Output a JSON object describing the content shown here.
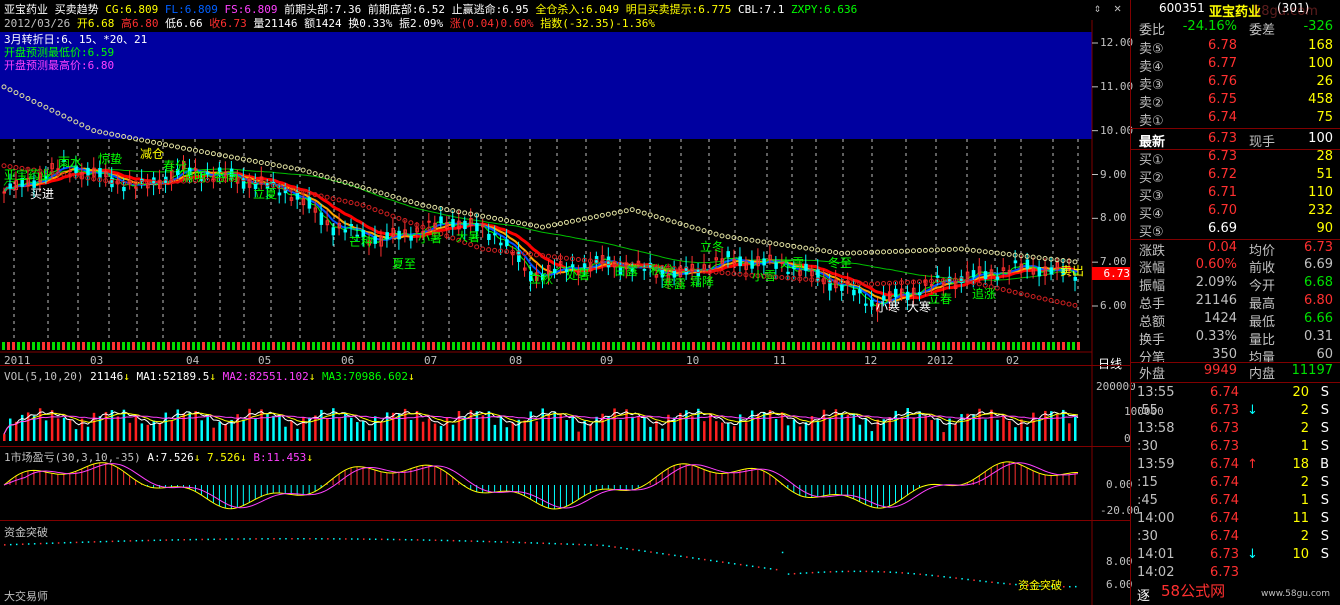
{
  "header": {
    "row1": [
      {
        "text": "亚宝药业",
        "color": "#ffffff"
      },
      {
        "text": "买卖趋势",
        "color": "#ffffff"
      },
      {
        "text": "CG:6.809",
        "color": "#ffff00"
      },
      {
        "text": "FL:6.809",
        "color": "#0060ff"
      },
      {
        "text": "FS:6.809",
        "color": "#ff40ff"
      },
      {
        "text": "前期头部:7.36",
        "color": "#ffffff"
      },
      {
        "text": "前期底部:6.52",
        "color": "#ffffff"
      },
      {
        "text": "止赢逃命:6.95",
        "color": "#ffffff"
      },
      {
        "text": "全仓杀入:6.049",
        "color": "#ffff00"
      },
      {
        "text": "明日买卖提示:6.775",
        "color": "#ffff00"
      },
      {
        "text": "CBL:7.1",
        "color": "#ffffff"
      },
      {
        "text": "ZXPY:6.636",
        "color": "#00ff00"
      }
    ],
    "row2": [
      {
        "text": "2012/03/26",
        "color": "#c0c0c0"
      },
      {
        "text": "开6.68",
        "color": "#ffff00"
      },
      {
        "text": "高6.80",
        "color": "#ff3030"
      },
      {
        "text": "低6.66",
        "color": "#ffffff"
      },
      {
        "text": "收6.73",
        "color": "#ff3030"
      },
      {
        "text": "量21146",
        "color": "#ffffff"
      },
      {
        "text": "额1424",
        "color": "#ffffff"
      },
      {
        "text": "换0.33%",
        "color": "#ffffff"
      },
      {
        "text": "振2.09%",
        "color": "#ffffff"
      },
      {
        "text": "涨(0.04)0.60%",
        "color": "#ff3030"
      },
      {
        "text": "指数(-32.35)-1.36%",
        "color": "#ffff00"
      }
    ],
    "overlay": {
      "line1": "3月转折日:6、15、*20、21",
      "line2": "开盘预测最低价:6.59",
      "line3": "开盘预测最高价:6.80",
      "left_label": "亚宝药业"
    }
  },
  "price_axis": {
    "ticks": [
      "12.00",
      "11.00",
      "10.00",
      "9.00",
      "8.00",
      "7.00",
      "6.00"
    ],
    "current": "6.73"
  },
  "date_axis": [
    "2011",
    "03",
    "04",
    "05",
    "06",
    "07",
    "08",
    "09",
    "10",
    "11",
    "12",
    "2012",
    "02",
    "03"
  ],
  "period_label": "日线",
  "annotations": [
    {
      "text": "雨水",
      "color": "#00ff00"
    },
    {
      "text": "惊蛰",
      "color": "#00ff00"
    },
    {
      "text": "减仓",
      "color": "#ffff00"
    },
    {
      "text": "春分",
      "color": "#00ff00"
    },
    {
      "text": "清明",
      "color": "#00ff00"
    },
    {
      "text": "谷雨",
      "color": "#00ff00"
    },
    {
      "text": "买进",
      "color": "#ffffff"
    },
    {
      "text": "立夏",
      "color": "#00ff00"
    },
    {
      "text": "芒种",
      "color": "#00ff00"
    },
    {
      "text": "夏至",
      "color": "#00ff00"
    },
    {
      "text": "小暑",
      "color": "#00ff00"
    },
    {
      "text": "大暑",
      "color": "#00ff00"
    },
    {
      "text": "立秋",
      "color": "#00ff00"
    },
    {
      "text": "处暑",
      "color": "#00ff00"
    },
    {
      "text": "白露",
      "color": "#00ff00"
    },
    {
      "text": "秋分",
      "color": "#00ff00"
    },
    {
      "text": "寒露",
      "color": "#00ff00"
    },
    {
      "text": "霜降",
      "color": "#00ff00"
    },
    {
      "text": "立冬",
      "color": "#00ff00"
    },
    {
      "text": "小雪",
      "color": "#00ff00"
    },
    {
      "text": "大雪",
      "color": "#00ff00"
    },
    {
      "text": "冬至",
      "color": "#00ff00"
    },
    {
      "text": "小寒",
      "color": "#ffffff"
    },
    {
      "text": "大寒",
      "color": "#ffffff"
    },
    {
      "text": "立春",
      "color": "#00ff00"
    },
    {
      "text": "追涨",
      "color": "#00ff00"
    },
    {
      "text": "卖出",
      "color": "#ffff00"
    }
  ],
  "vol_panel": {
    "title": "VOL(5,10,20)",
    "v": "21146",
    "ma1": "MA1:52189.5",
    "ma2": "MA2:82551.102",
    "ma3": "MA3:70986.602",
    "ticks": [
      "200000",
      "100000",
      "0"
    ]
  },
  "osc_panel": {
    "title": "1市场盈亏(30,3,10,-35)",
    "a": "A:7.526",
    "b": "7.526",
    "c": "B:11.453",
    "ticks": [
      "0.00",
      "-20.00"
    ]
  },
  "fund_panel": {
    "title": "资金突破",
    "ticks": [
      "8.00",
      "6.00"
    ],
    "bottom_label": "大交易师",
    "mark": "资金突破"
  },
  "quote": {
    "code": "600351",
    "name": "亚宝药业",
    "tag": "(301)",
    "weibi_label": "委比",
    "weibi": "-24.16%",
    "weicha_label": "委差",
    "weicha": "-326",
    "asks": [
      {
        "label": "卖⑤",
        "price": "6.78",
        "vol": "168"
      },
      {
        "label": "卖④",
        "price": "6.77",
        "vol": "100"
      },
      {
        "label": "卖③",
        "price": "6.76",
        "vol": "26"
      },
      {
        "label": "卖②",
        "price": "6.75",
        "vol": "458"
      },
      {
        "label": "卖①",
        "price": "6.74",
        "vol": "75"
      }
    ],
    "last_label": "最新",
    "last": "6.73",
    "xianshou_label": "现手",
    "xianshou": "100",
    "bids": [
      {
        "label": "买①",
        "price": "6.73",
        "vol": "28"
      },
      {
        "label": "买②",
        "price": "6.72",
        "vol": "51"
      },
      {
        "label": "买③",
        "price": "6.71",
        "vol": "110"
      },
      {
        "label": "买④",
        "price": "6.70",
        "vol": "232"
      },
      {
        "label": "买⑤",
        "price": "6.69",
        "vol": "90"
      }
    ],
    "stats": [
      {
        "l1": "涨跌",
        "v1": "0.04",
        "c1": "#ff3030",
        "l2": "均价",
        "v2": "6.73",
        "c2": "#ff3030"
      },
      {
        "l1": "涨幅",
        "v1": "0.60%",
        "c1": "#ff3030",
        "l2": "前收",
        "v2": "6.69",
        "c2": "#c0c0c0"
      },
      {
        "l1": "振幅",
        "v1": "2.09%",
        "c1": "#c0c0c0",
        "l2": "今开",
        "v2": "6.68",
        "c2": "#00e000"
      },
      {
        "l1": "总手",
        "v1": "21146",
        "c1": "#c0c0c0",
        "l2": "最高",
        "v2": "6.80",
        "c2": "#ff3030"
      },
      {
        "l1": "总额",
        "v1": "1424",
        "c1": "#c0c0c0",
        "l2": "最低",
        "v2": "6.66",
        "c2": "#00e000"
      },
      {
        "l1": "换手",
        "v1": "0.33%",
        "c1": "#c0c0c0",
        "l2": "量比",
        "v2": "0.31",
        "c2": "#c0c0c0"
      },
      {
        "l1": "分笔",
        "v1": "350",
        "c1": "#c0c0c0",
        "l2": "均量",
        "v2": "60",
        "c2": "#c0c0c0"
      }
    ],
    "waipan_label": "外盘",
    "waipan": "9949",
    "neipan_label": "内盘",
    "neipan": "11197"
  },
  "ticks": [
    {
      "time": "13:55",
      "price": "6.74",
      "arrow": "",
      "vol": "20",
      "side": "S",
      "pc": "#ff3030"
    },
    {
      "time": ":55",
      "price": "6.73",
      "arrow": "↓",
      "vol": "2",
      "side": "S",
      "pc": "#ff3030"
    },
    {
      "time": "13:58",
      "price": "6.73",
      "arrow": "",
      "vol": "2",
      "side": "S",
      "pc": "#ff3030"
    },
    {
      "time": ":30",
      "price": "6.73",
      "arrow": "",
      "vol": "1",
      "side": "S",
      "pc": "#ff3030"
    },
    {
      "time": "13:59",
      "price": "6.74",
      "arrow": "↑",
      "vol": "18",
      "side": "B",
      "pc": "#ff3030"
    },
    {
      "time": ":15",
      "price": "6.74",
      "arrow": "",
      "vol": "2",
      "side": "S",
      "pc": "#ff3030"
    },
    {
      "time": ":45",
      "price": "6.74",
      "arrow": "",
      "vol": "1",
      "side": "S",
      "pc": "#ff3030"
    },
    {
      "time": "14:00",
      "price": "6.74",
      "arrow": "",
      "vol": "11",
      "side": "S",
      "pc": "#ff3030"
    },
    {
      "time": ":30",
      "price": "6.74",
      "arrow": "",
      "vol": "2",
      "side": "S",
      "pc": "#ff3030"
    },
    {
      "time": "14:01",
      "price": "6.73",
      "arrow": "↓",
      "vol": "10",
      "side": "S",
      "pc": "#ff3030"
    },
    {
      "time": "14:02",
      "price": "6.73",
      "arrow": "",
      "vol": "",
      "side": "",
      "pc": "#ff3030"
    }
  ],
  "footer": {
    "left": "逐",
    "logo": "58公式网",
    "url": "www.58gu.com"
  },
  "watermark": "58gu.com"
}
